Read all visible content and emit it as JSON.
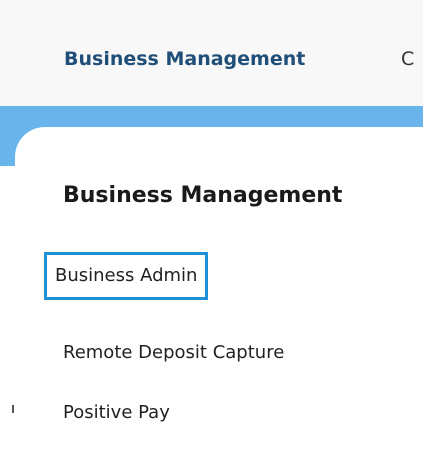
{
  "topnav": {
    "active_label": "Business Management",
    "next_label": "C"
  },
  "dropdown": {
    "heading": "Business Management",
    "items": [
      {
        "label": "Business Admin"
      },
      {
        "label": "Remote Deposit Capture"
      },
      {
        "label": "Positive Pay"
      }
    ]
  },
  "colors": {
    "nav_active_text": "#1f4e79",
    "accent_band": "#6ab4ec",
    "focus_ring": "#1e90d6"
  }
}
